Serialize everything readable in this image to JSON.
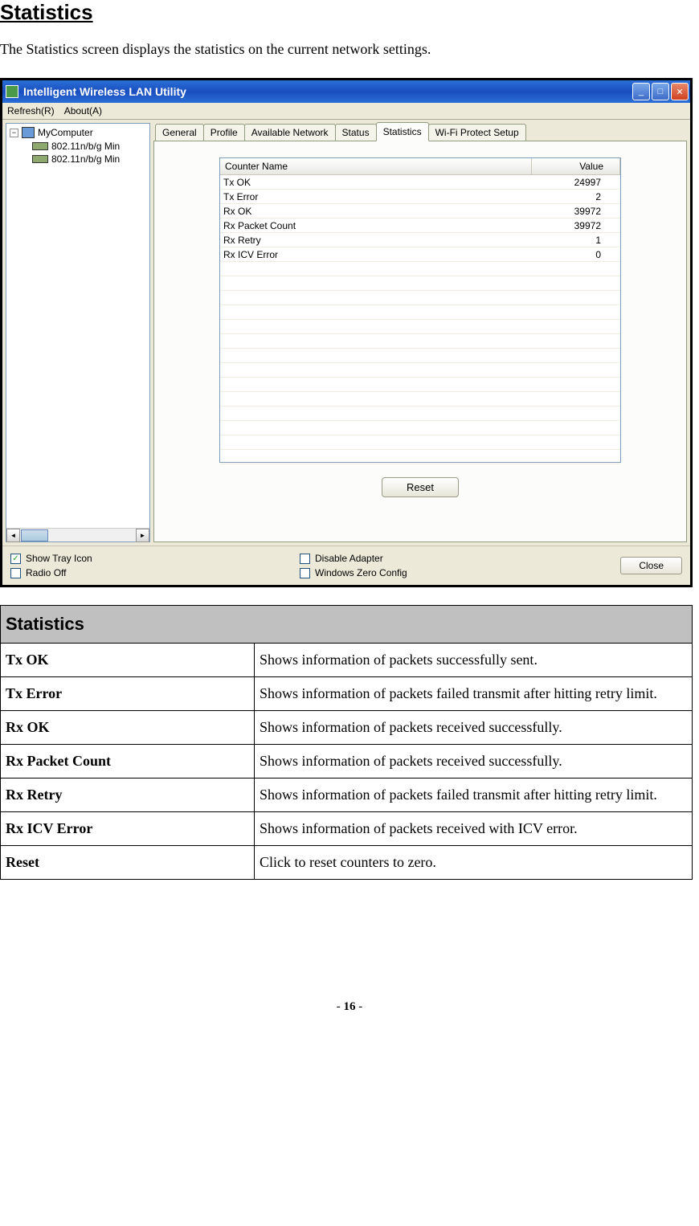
{
  "page": {
    "title": "Statistics",
    "intro": "The Statistics screen displays the statistics on the current network settings.",
    "pagenum_prefix": "- ",
    "pagenum": "16",
    "pagenum_suffix": " -"
  },
  "window": {
    "title": "Intelligent Wireless LAN Utility",
    "menu": {
      "refresh": "Refresh(R)",
      "about": "About(A)"
    },
    "tree": {
      "root": "MyComputer",
      "children": [
        "802.11n/b/g Min",
        "802.11n/b/g Min"
      ]
    },
    "tabs": [
      "General",
      "Profile",
      "Available Network",
      "Status",
      "Statistics",
      "Wi-Fi Protect Setup"
    ],
    "active_tab": "Statistics",
    "stats": {
      "headers": {
        "name": "Counter Name",
        "value": "Value"
      },
      "rows": [
        {
          "name": "Tx OK",
          "value": "24997"
        },
        {
          "name": "Tx Error",
          "value": "2"
        },
        {
          "name": "Rx OK",
          "value": "39972"
        },
        {
          "name": "Rx Packet Count",
          "value": "39972"
        },
        {
          "name": "Rx Retry",
          "value": "1"
        },
        {
          "name": "Rx ICV Error",
          "value": "0"
        }
      ],
      "reset_button": "Reset"
    },
    "bottom": {
      "show_tray": {
        "label": "Show Tray Icon",
        "checked": true
      },
      "radio_off": {
        "label": "Radio Off",
        "checked": false
      },
      "disable_adapter": {
        "label": "Disable Adapter",
        "checked": false
      },
      "win_zero": {
        "label": "Windows Zero Config",
        "checked": false
      },
      "close": "Close"
    }
  },
  "defs": {
    "header": "Statistics",
    "rows": [
      {
        "term": "Tx OK",
        "desc": "Shows information of packets successfully sent."
      },
      {
        "term": "Tx Error",
        "desc": "Shows information of packets failed transmit after hitting retry limit."
      },
      {
        "term": "Rx OK",
        "desc": "Shows information of packets received successfully."
      },
      {
        "term": "Rx Packet Count",
        "desc": "Shows information of packets received successfully."
      },
      {
        "term": "Rx Retry",
        "desc": "Shows information of packets failed transmit after hitting retry limit."
      },
      {
        "term": "Rx ICV Error",
        "desc": "Shows information of packets received with ICV error."
      },
      {
        "term": "Reset",
        "desc": "Click to reset counters to zero."
      }
    ]
  }
}
